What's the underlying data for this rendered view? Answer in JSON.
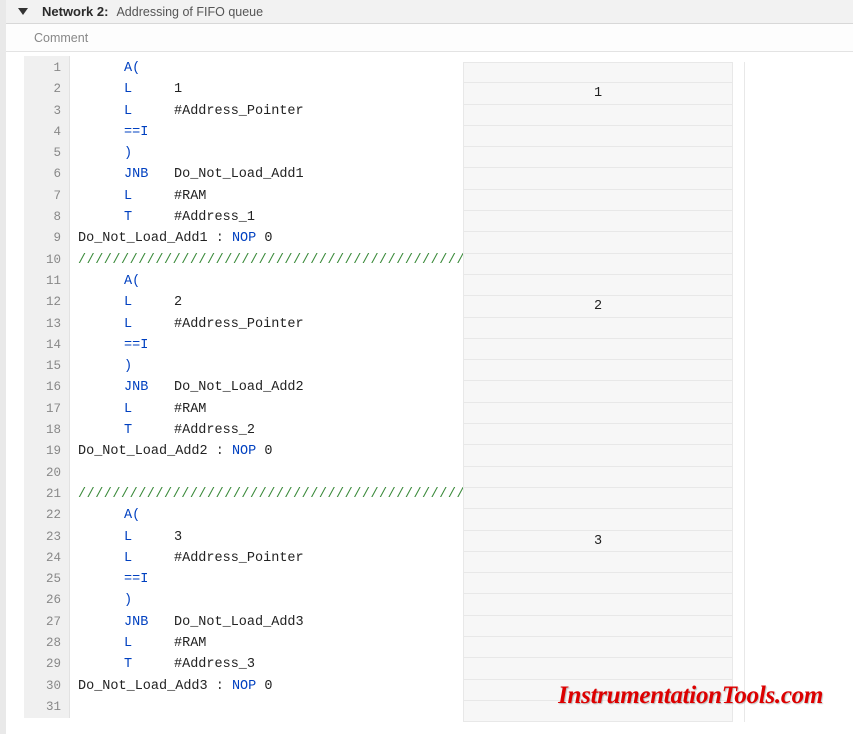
{
  "header": {
    "network_label": "Network 2:",
    "network_title": "Addressing of FIFO queue",
    "comment_placeholder": "Comment"
  },
  "code": {
    "lines": [
      {
        "n": 1,
        "ind": 1,
        "op": "A(",
        "arg": ""
      },
      {
        "n": 2,
        "ind": 1,
        "op": "L",
        "arg": "1"
      },
      {
        "n": 3,
        "ind": 1,
        "op": "L",
        "arg": "#Address_Pointer"
      },
      {
        "n": 4,
        "ind": 1,
        "op": "==I",
        "arg": ""
      },
      {
        "n": 5,
        "ind": 1,
        "op": ")",
        "arg": ""
      },
      {
        "n": 6,
        "ind": 1,
        "op": "JNB",
        "arg": "Do_Not_Load_Add1"
      },
      {
        "n": 7,
        "ind": 1,
        "op": "L",
        "arg": "#RAM"
      },
      {
        "n": 8,
        "ind": 1,
        "op": "T",
        "arg": "#Address_1"
      },
      {
        "n": 9,
        "ind": 0,
        "label": "Do_Not_Load_Add1",
        "kw": "NOP",
        "karg": "0"
      },
      {
        "n": 10,
        "ind": 0,
        "slash": "////////////////////////////////////////////////////."
      },
      {
        "n": 11,
        "ind": 1,
        "op": "A(",
        "arg": ""
      },
      {
        "n": 12,
        "ind": 1,
        "op": "L",
        "arg": "2"
      },
      {
        "n": 13,
        "ind": 1,
        "op": "L",
        "arg": "#Address_Pointer"
      },
      {
        "n": 14,
        "ind": 1,
        "op": "==I",
        "arg": ""
      },
      {
        "n": 15,
        "ind": 1,
        "op": ")",
        "arg": ""
      },
      {
        "n": 16,
        "ind": 1,
        "op": "JNB",
        "arg": "Do_Not_Load_Add2"
      },
      {
        "n": 17,
        "ind": 1,
        "op": "L",
        "arg": "#RAM"
      },
      {
        "n": 18,
        "ind": 1,
        "op": "T",
        "arg": "#Address_2"
      },
      {
        "n": 19,
        "ind": 0,
        "label": "Do_Not_Load_Add2",
        "kw": "NOP",
        "karg": "0"
      },
      {
        "n": 20,
        "ind": 0,
        "blank": true
      },
      {
        "n": 21,
        "ind": 0,
        "slash": "////////////////////////////////////////////////////."
      },
      {
        "n": 22,
        "ind": 1,
        "op": "A(",
        "arg": ""
      },
      {
        "n": 23,
        "ind": 1,
        "op": "L",
        "arg": "3"
      },
      {
        "n": 24,
        "ind": 1,
        "op": "L",
        "arg": "#Address_Pointer"
      },
      {
        "n": 25,
        "ind": 1,
        "op": "==I",
        "arg": ""
      },
      {
        "n": 26,
        "ind": 1,
        "op": ")",
        "arg": ""
      },
      {
        "n": 27,
        "ind": 1,
        "op": "JNB",
        "arg": "Do_Not_Load_Add3"
      },
      {
        "n": 28,
        "ind": 1,
        "op": "L",
        "arg": "#RAM"
      },
      {
        "n": 29,
        "ind": 1,
        "op": "T",
        "arg": "#Address_3"
      },
      {
        "n": 30,
        "ind": 0,
        "label": "Do_Not_Load_Add3",
        "kw": "NOP",
        "karg": "0"
      },
      {
        "n": 31,
        "ind": 0,
        "blank": true
      }
    ],
    "side_values": {
      "2": "1",
      "12": "2",
      "23": "3"
    }
  },
  "watermark": "InstrumentationTools.com"
}
